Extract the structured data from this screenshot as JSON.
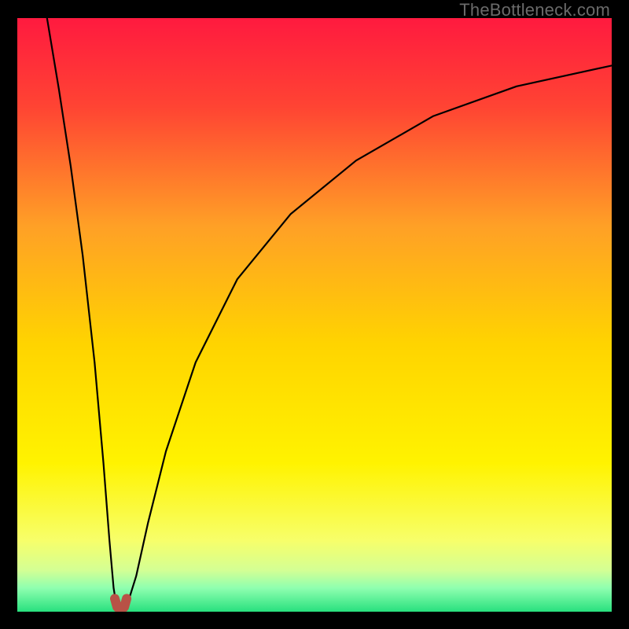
{
  "watermark": "TheBottleneck.com",
  "chart_data": {
    "type": "line",
    "title": "",
    "xlabel": "",
    "ylabel": "",
    "xlim": [
      0,
      100
    ],
    "ylim": [
      0,
      100
    ],
    "grid": false,
    "background_gradient": {
      "stops": [
        {
          "pct": 0,
          "color": "#ff1a3f"
        },
        {
          "pct": 15,
          "color": "#ff4433"
        },
        {
          "pct": 35,
          "color": "#ffa026"
        },
        {
          "pct": 55,
          "color": "#ffd400"
        },
        {
          "pct": 75,
          "color": "#fff300"
        },
        {
          "pct": 88,
          "color": "#f7ff6a"
        },
        {
          "pct": 93,
          "color": "#d4ff94"
        },
        {
          "pct": 96,
          "color": "#8fffb0"
        },
        {
          "pct": 100,
          "color": "#28e07e"
        }
      ]
    },
    "series": [
      {
        "name": "left-arm",
        "role": "bottleneck-curve-left",
        "x": [
          5,
          7,
          9,
          11,
          13,
          14.5,
          15.5,
          16.2,
          16.6
        ],
        "y": [
          100,
          88,
          75,
          60,
          42,
          25,
          12,
          4,
          1.5
        ]
      },
      {
        "name": "right-arm",
        "role": "bottleneck-curve-right",
        "x": [
          18.6,
          20,
          22,
          25,
          30,
          37,
          46,
          57,
          70,
          84,
          100
        ],
        "y": [
          1.5,
          6,
          15,
          27,
          42,
          56,
          67,
          76,
          83.5,
          88.5,
          92
        ]
      },
      {
        "name": "minimum-marker",
        "role": "optimum-point",
        "x": [
          16.4,
          16.8,
          17.2,
          17.6,
          18.0,
          18.4
        ],
        "y": [
          2.2,
          0.8,
          0.4,
          0.4,
          0.8,
          2.2
        ],
        "stroke": "#b85246",
        "stroke_width": 12
      }
    ],
    "annotations": []
  }
}
